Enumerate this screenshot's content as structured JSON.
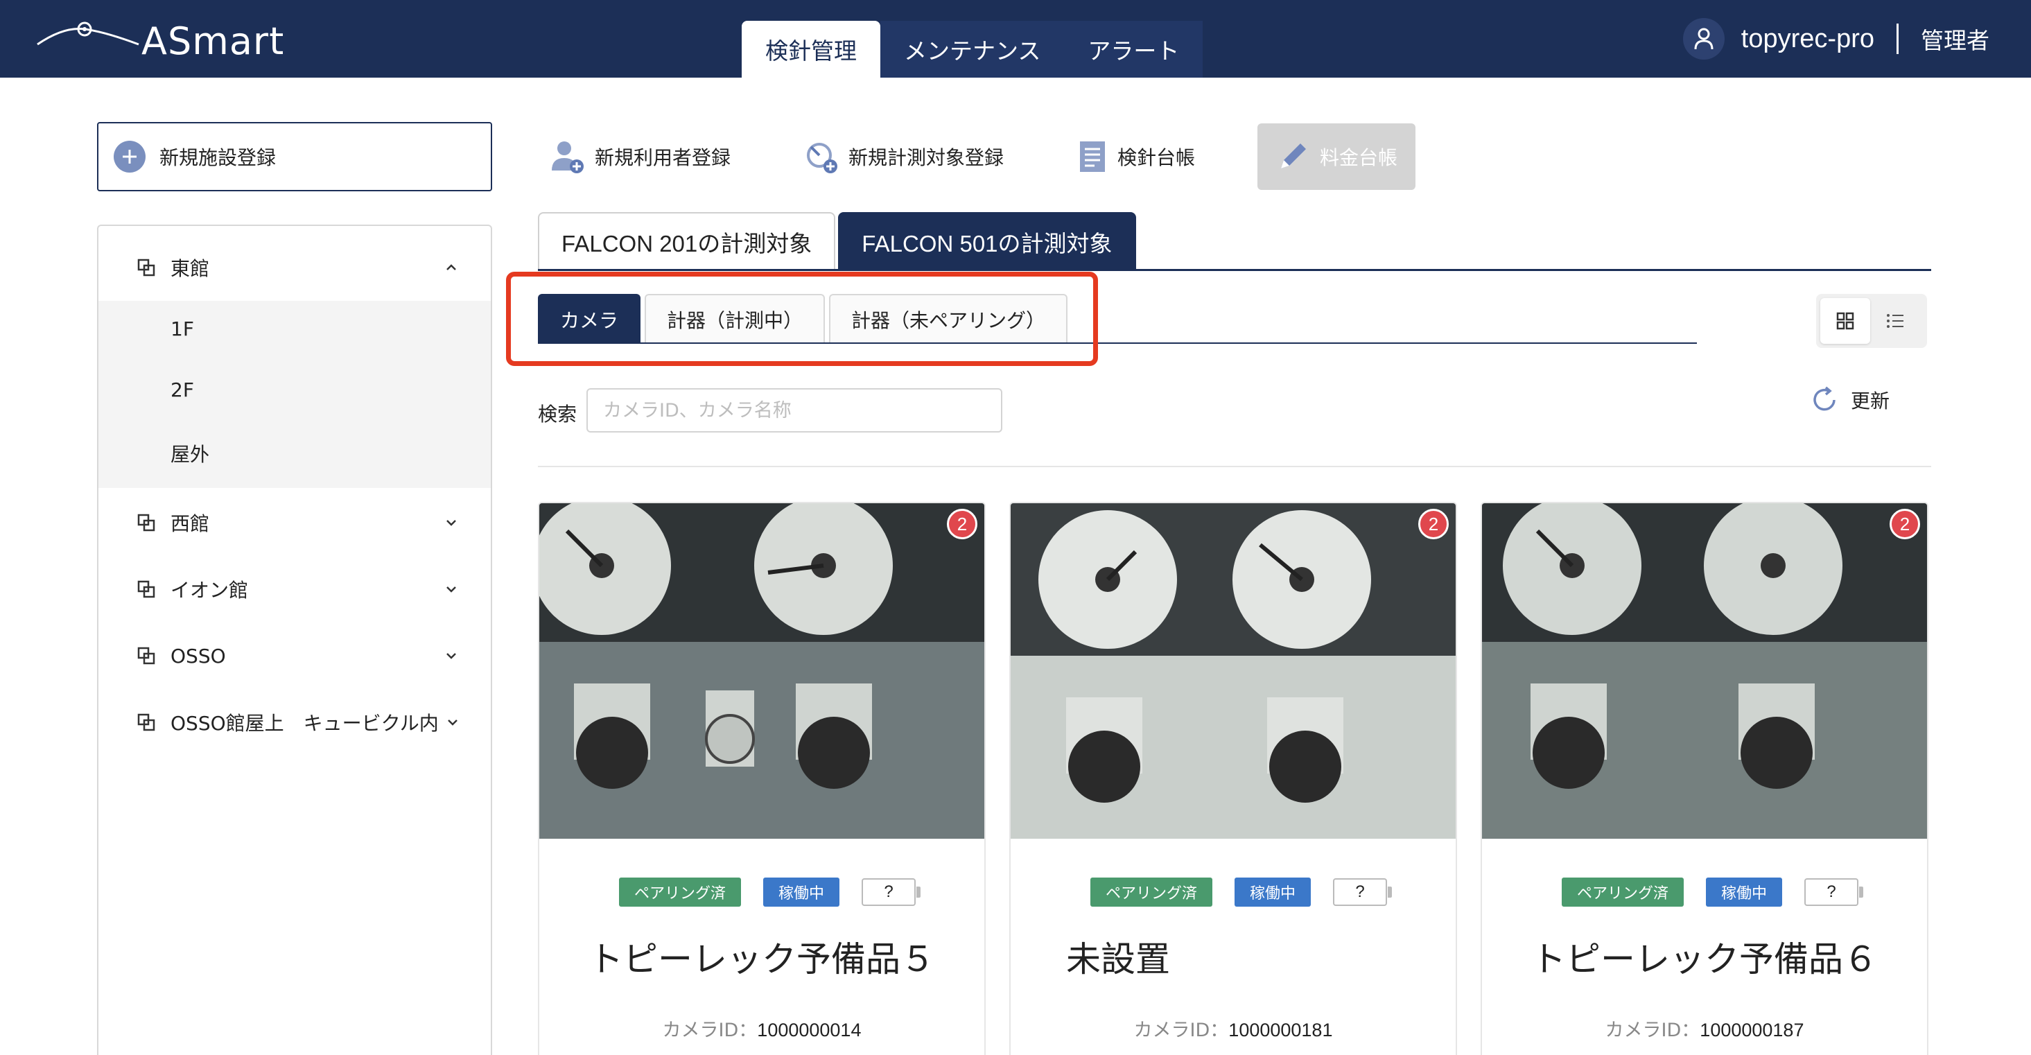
{
  "app": {
    "logo_text": "ASmart"
  },
  "nav": {
    "tabs": [
      {
        "label": "検針管理"
      },
      {
        "label": "メンテナンス"
      },
      {
        "label": "アラート"
      }
    ]
  },
  "user": {
    "name": "topyrec-pro",
    "role": "管理者"
  },
  "sidebar": {
    "new_facility_label": "新規施設登録",
    "items": [
      {
        "label": "東館",
        "expanded": true,
        "children": [
          {
            "label": "1F"
          },
          {
            "label": "2F"
          },
          {
            "label": "屋外"
          }
        ]
      },
      {
        "label": "西館"
      },
      {
        "label": "イオン館"
      },
      {
        "label": "OSSO"
      },
      {
        "label": "OSSO館屋上　キュービクル内"
      }
    ]
  },
  "toolbar": {
    "new_user_label": "新規利用者登録",
    "new_target_label": "新規計測対象登録",
    "inspection_ledger_label": "検針台帳",
    "fee_ledger_label": "料金台帳"
  },
  "device_tabs": [
    {
      "label": "FALCON 201の計測対象"
    },
    {
      "label": "FALCON 501の計測対象"
    }
  ],
  "sub_tabs": [
    {
      "label": "カメラ"
    },
    {
      "label": "計器（計測中）"
    },
    {
      "label": "計器（未ペアリング）"
    }
  ],
  "search": {
    "label": "検索",
    "placeholder": "カメラID、カメラ名称",
    "value": ""
  },
  "refresh_label": "更新",
  "cards": [
    {
      "badge": "2",
      "pairing": "ペアリング済",
      "status": "稼働中",
      "battery": "?",
      "name": "トピーレック予備品５",
      "id_label": "カメラID：",
      "id_value": "1000000014"
    },
    {
      "badge": "2",
      "pairing": "ペアリング済",
      "status": "稼働中",
      "battery": "?",
      "name": "未設置",
      "id_label": "カメラID：",
      "id_value": "1000000181"
    },
    {
      "badge": "2",
      "pairing": "ペアリング済",
      "status": "稼働中",
      "battery": "?",
      "name": "トピーレック予備品６",
      "id_label": "カメラID：",
      "id_value": "1000000187"
    }
  ],
  "colors": {
    "header_bg": "#1c2f57",
    "accent": "#1c2f57",
    "tag_green": "#4a9a6d",
    "tag_blue": "#3b78c9",
    "badge_red": "#e0474d",
    "highlight": "#e53a20"
  }
}
